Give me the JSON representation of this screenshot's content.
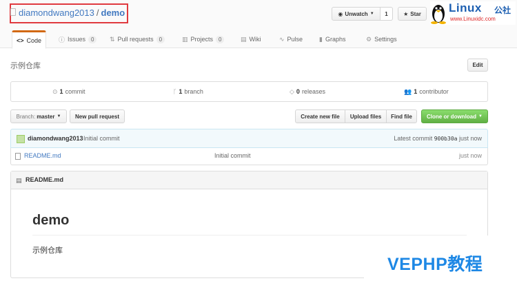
{
  "repo": {
    "owner": "diamondwang2013",
    "separator": "/",
    "name": "demo"
  },
  "actions": {
    "watch_label": "Unwatch",
    "watch_count": "1",
    "star_label": "Star"
  },
  "logo": {
    "text": "Linux",
    "cn": "公社",
    "url": "www.Linuxidc.com"
  },
  "tabs": [
    {
      "label": "Code",
      "icon": "code-icon"
    },
    {
      "label": "Issues",
      "count": "0",
      "icon": "issue-icon"
    },
    {
      "label": "Pull requests",
      "count": "0",
      "icon": "pull-request-icon"
    },
    {
      "label": "Projects",
      "count": "0",
      "icon": "project-icon"
    },
    {
      "label": "Wiki",
      "icon": "book-icon"
    },
    {
      "label": "Pulse",
      "icon": "pulse-icon"
    },
    {
      "label": "Graphs",
      "icon": "graph-icon"
    },
    {
      "label": "Settings",
      "icon": "gear-icon"
    }
  ],
  "description": "示例仓库",
  "edit_label": "Edit",
  "summary": {
    "commits_num": "1",
    "commits_label": "commit",
    "branches_num": "1",
    "branches_label": "branch",
    "releases_num": "0",
    "releases_label": "releases",
    "contributors_num": "1",
    "contributors_label": "contributor"
  },
  "file_nav": {
    "branch_prefix": "Branch:",
    "branch_name": "master",
    "new_pr_label": "New pull request",
    "create_file_label": "Create new file",
    "upload_label": "Upload files",
    "find_label": "Find file",
    "clone_label": "Clone or download"
  },
  "commit": {
    "author": "diamondwang2013",
    "message": "Initial commit",
    "latest_prefix": "Latest commit",
    "sha": "900b30a",
    "age": "just now"
  },
  "files": [
    {
      "name": "README.md",
      "message": "Initial commit",
      "age": "just now"
    }
  ],
  "readme": {
    "header": "README.md",
    "heading": "demo",
    "body": "示例仓库"
  },
  "watermark": "VEPHP教程",
  "colors": {
    "link": "#4078c0",
    "selected_tab_accent": "#d26911",
    "clone_green": "#60b044",
    "highlight_border": "#e0393e"
  }
}
